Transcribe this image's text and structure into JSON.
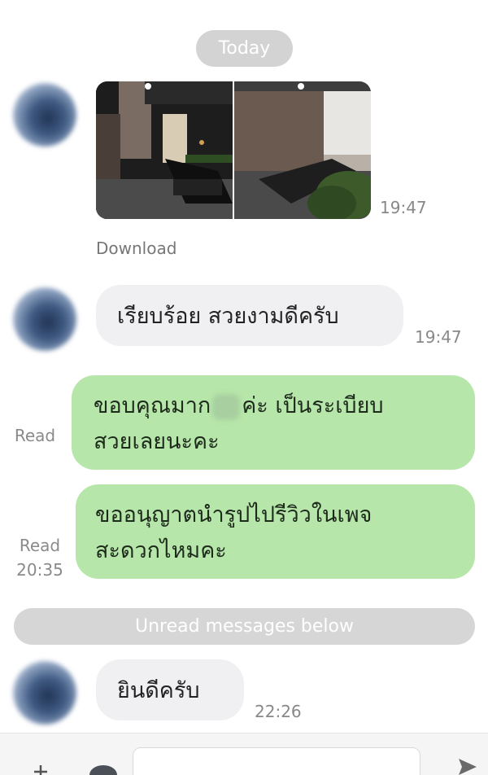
{
  "chat": {
    "date_label": "Today",
    "messages": [
      {
        "type": "photos",
        "time": "19:47",
        "download_label": "Download"
      },
      {
        "type": "incoming",
        "text": "เรียบร้อย สวยงามดีครับ",
        "time": "19:47"
      },
      {
        "type": "outgoing",
        "line1": "ขอบคุณมาก",
        "line1b": "ค่ะ เป็นระเบียบ",
        "line2": "สวยเลยนะคะ",
        "status": "Read"
      },
      {
        "type": "outgoing",
        "line1": "ขออนุญาตนำรูปไปรีวิวในเพจ",
        "line2": "สะดวกไหมคะ",
        "status": "Read",
        "time": "20:35"
      },
      {
        "type": "incoming",
        "text": "ยินดีครับ",
        "time": "22:26"
      }
    ],
    "unread_label": "Unread messages below"
  },
  "icons": {
    "add": "plus-icon",
    "send": "send-icon",
    "camera": "camera-icon"
  },
  "colors": {
    "outgoing_bubble": "#b6e6a9",
    "incoming_bubble": "#f0f0f2",
    "pill": "#d3d3d3"
  }
}
